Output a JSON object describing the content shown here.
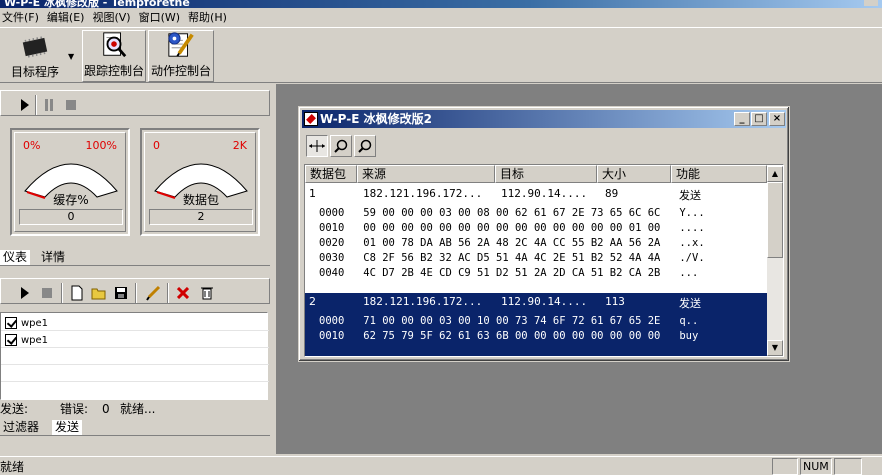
{
  "app_title": "W-P-E 冰枫修改版 - Tempforethe",
  "menu": [
    {
      "label": "文件",
      "key": "(F)"
    },
    {
      "label": "编辑",
      "key": "(E)"
    },
    {
      "label": "视图",
      "key": "(V)"
    },
    {
      "label": "窗口",
      "key": "(W)"
    },
    {
      "label": "帮助",
      "key": "(H)"
    }
  ],
  "toolbar": {
    "target_label": "目标程序",
    "trace_label": "跟踪控制台",
    "action_label": "动作控制台"
  },
  "meters": [
    {
      "min": "0%",
      "max": "100%",
      "label": "缓存%",
      "value": "0",
      "level": 0.0
    },
    {
      "min": "0",
      "max": "2K",
      "label": "数据包",
      "value": "2",
      "level": 0.0
    }
  ],
  "tabs_top": [
    "仪表",
    "详情"
  ],
  "list_items": [
    "wpe1",
    "wpe1"
  ],
  "send_status": {
    "sent_label": "发送:",
    "errors_label": "错误:",
    "errors_value": "0",
    "state": "就绪..."
  },
  "tabs_bottom": [
    "过滤器",
    "发送"
  ],
  "statusbar": {
    "text": "就绪",
    "num": "NUM"
  },
  "child_window": {
    "title": "W-P-E 冰枫修改版2",
    "columns": [
      "数据包",
      "来源",
      "目标",
      "大小",
      "功能"
    ],
    "packets": [
      {
        "id": "1",
        "source": "182.121.196.172...",
        "target": "112.90.14....",
        "size": "89",
        "function": "发送",
        "selected": false,
        "rows": [
          {
            "offset": "0000",
            "hex": "59 00 00 00 03 00 08 00 62 61 67 2E 73 65 6C 6C",
            "ascii": "Y..."
          },
          {
            "offset": "0010",
            "hex": "00 00 00 00 00 00 00 00 00 00 00 00 00 00 01 00",
            "ascii": "...."
          },
          {
            "offset": "0020",
            "hex": "01 00 78 DA AB 56 2A 48 2C 4A CC 55 B2 AA 56 2A",
            "ascii": "..x."
          },
          {
            "offset": "0030",
            "hex": "C8 2F 56 B2 32 AC D5 51 4A 4C 2E 51 B2 52 4A 4A",
            "ascii": "./V."
          },
          {
            "offset": "0040",
            "hex": "4C D7 2B 4E CD C9 51 D2 51 2A 2D CA 51 B2 CA 2B",
            "ascii": "..."
          }
        ]
      },
      {
        "id": "2",
        "source": "182.121.196.172...",
        "target": "112.90.14....",
        "size": "113",
        "function": "发送",
        "selected": true,
        "rows": [
          {
            "offset": "0000",
            "hex": "71 00 00 00 03 00 10 00 73 74 6F 72 61 67 65 2E",
            "ascii": "q.."
          },
          {
            "offset": "0010",
            "hex": "62 75 79 5F 62 61 63 6B 00 00 00 00 00 00 00 00",
            "ascii": "buy"
          }
        ]
      }
    ]
  },
  "icons": {
    "target": "chip-icon",
    "trace": "magnifier-doc-icon",
    "action": "pencil-gear-icon"
  },
  "colors": {
    "selection": "#0a246a",
    "meter_red": "#e00000",
    "face": "#d4d0c8"
  }
}
